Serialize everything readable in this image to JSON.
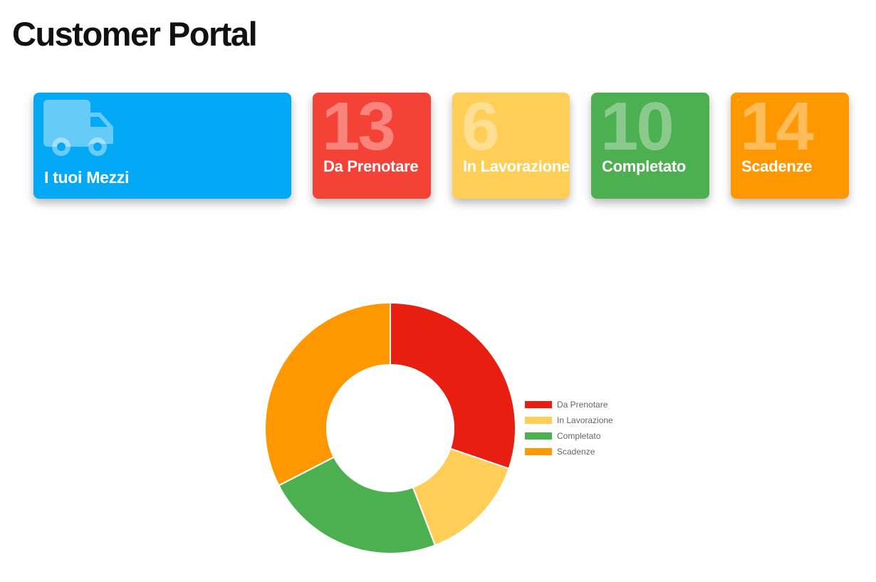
{
  "page": {
    "title": "Customer Portal"
  },
  "cards": {
    "mezzi": {
      "label": "I tuoi Mezzi",
      "icon": "truck-icon",
      "color": "#03A9F4"
    },
    "prenotare": {
      "count": "13",
      "label": "Da Prenotare",
      "color": "#F44336"
    },
    "lavorazione": {
      "count": "6",
      "label": "In Lavorazione",
      "color": "#FFCE56"
    },
    "completato": {
      "count": "10",
      "label": "Completato",
      "color": "#4CAF50"
    },
    "scadenze": {
      "count": "14",
      "label": "Scadenze",
      "color": "#FF9800"
    }
  },
  "chart_data": {
    "type": "pie",
    "variant": "doughnut",
    "categories": [
      "Da Prenotare",
      "In Lavorazione",
      "Completato",
      "Scadenze"
    ],
    "values": [
      13,
      6,
      10,
      14
    ],
    "colors": [
      "#E81E10",
      "#FFCE56",
      "#4CAF50",
      "#FF9800"
    ],
    "legend": "right"
  }
}
